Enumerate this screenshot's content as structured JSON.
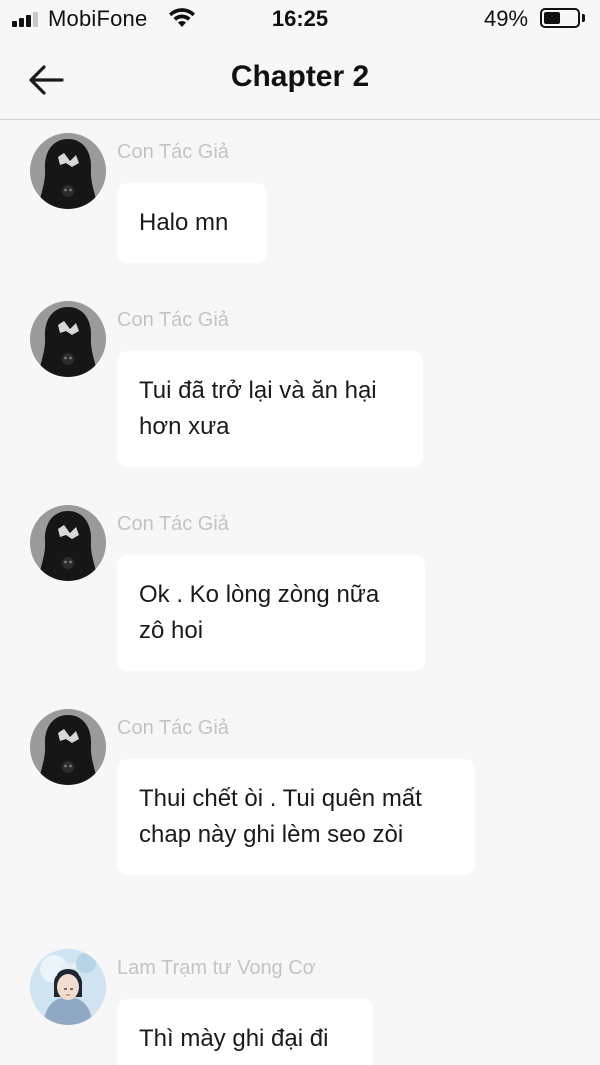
{
  "status_bar": {
    "carrier": "MobiFone",
    "time": "16:25",
    "battery_percent_label": "49%",
    "battery_level": 0.49,
    "signal_bars": 3,
    "signal_total": 4
  },
  "header": {
    "title": "Chapter 2",
    "back_icon": "arrow-left-icon"
  },
  "colors": {
    "background": "#f7f7f7",
    "bubble": "#ffffff",
    "sender_name": "#c4c4c4",
    "text": "#1a1a1a"
  },
  "messages": [
    {
      "sender": "Con Tác Giả",
      "text": "Halo mn",
      "avatar": "hooded-figure-avatar"
    },
    {
      "sender": "Con Tác Giả",
      "text": "Tui đã trở lại và ăn hại\nhơn xưa",
      "avatar": "hooded-figure-avatar"
    },
    {
      "sender": "Con Tác Giả",
      "text": "Ok . Ko lòng zòng nữa\nzô hoi",
      "avatar": "hooded-figure-avatar"
    },
    {
      "sender": "Con Tác Giả",
      "text": "Thui chết òi . Tui quên mất\nchap này ghi lèm seo zòi",
      "avatar": "hooded-figure-avatar"
    },
    {
      "sender": "Lam Trạm tư Vong Cơ",
      "text": "Thì mày ghi đại đi",
      "avatar": "costume-character-avatar"
    }
  ]
}
